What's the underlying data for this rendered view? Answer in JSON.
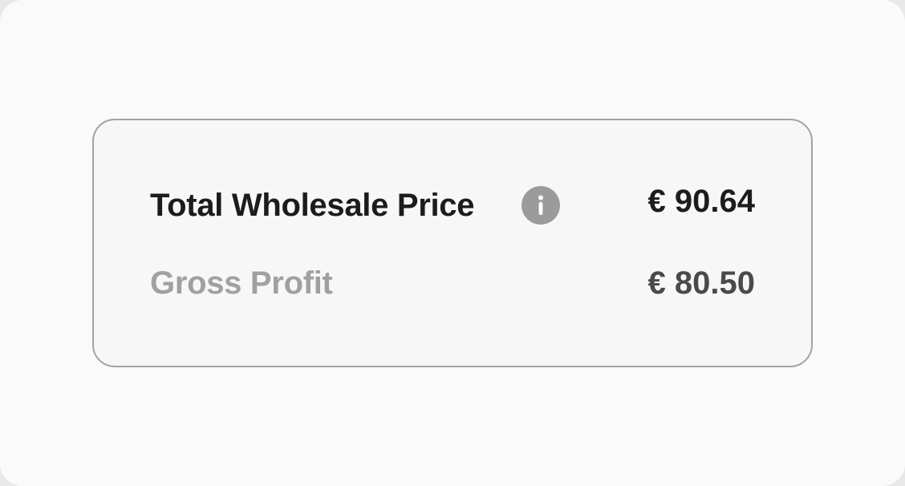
{
  "summary": {
    "total_wholesale": {
      "label": "Total Wholesale Price",
      "value": "€ 90.64",
      "icon": "info-icon"
    },
    "gross_profit": {
      "label": "Gross Profit",
      "value": "€ 80.50"
    }
  },
  "colors": {
    "card_border": "#a3a3a3",
    "card_background": "#f7f7f7",
    "primary_text": "#1c1c1c",
    "muted_label": "#a0a0a0",
    "secondary_value": "#4a4a4a",
    "info_icon": "#9b9b9b"
  }
}
